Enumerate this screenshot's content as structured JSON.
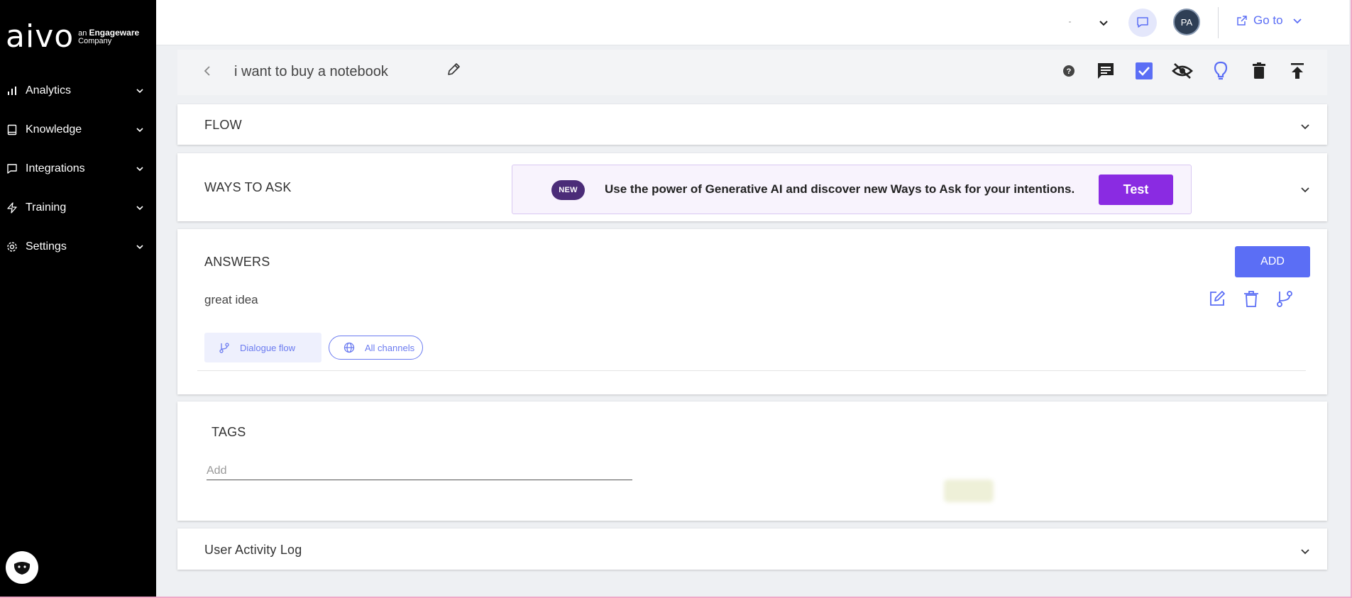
{
  "sidebar": {
    "logo": {
      "brand": "aivo",
      "tagline_prefix": "an",
      "tagline_company": "Engageware",
      "tagline_suffix": "Company"
    },
    "items": [
      {
        "label": "Analytics",
        "icon": "bar-chart-icon"
      },
      {
        "label": "Knowledge",
        "icon": "book-icon"
      },
      {
        "label": "Integrations",
        "icon": "message-square-icon"
      },
      {
        "label": "Training",
        "icon": "lightning-icon"
      },
      {
        "label": "Settings",
        "icon": "gear-icon"
      }
    ]
  },
  "topbar": {
    "avatar_initials": "PA",
    "goto_label": "Go to"
  },
  "intent": {
    "title": "i want to buy a notebook"
  },
  "sections": {
    "flow": {
      "title": "FLOW"
    },
    "ways_to_ask": {
      "title": "WAYS TO ASK",
      "promo_badge": "NEW",
      "promo_text": "Use the power of Generative AI and discover new Ways to Ask for your intentions.",
      "promo_button": "Test"
    },
    "answers": {
      "title": "ANSWERS",
      "add_button": "ADD",
      "items": [
        {
          "text": "great idea",
          "chip_flow": "Dialogue flow",
          "chip_channels": "All channels"
        }
      ]
    },
    "tags": {
      "title": "TAGS",
      "placeholder": "Add"
    },
    "activity": {
      "title": "User Activity Log"
    }
  },
  "colors": {
    "accent": "#5b6ef5",
    "promo_button": "#8a2be2",
    "badge": "#4b2c78",
    "sidebar_bg": "#000000"
  }
}
